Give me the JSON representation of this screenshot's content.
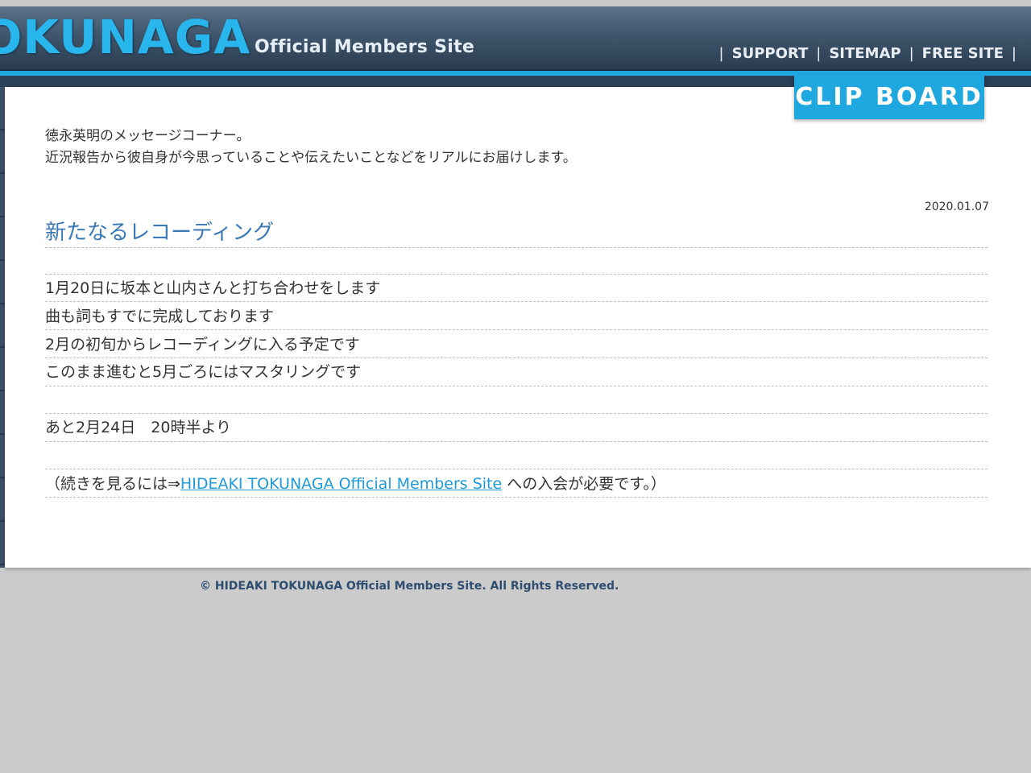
{
  "header": {
    "logo_main": "OKUNAGA",
    "logo_sub": "Official Members Site",
    "nav": [
      "SUPPORT",
      "SITEMAP",
      "FREE SITE"
    ],
    "separator": "|"
  },
  "clip_board_label": "CLIP BOARD",
  "intro": {
    "line1": "徳永英明のメッセージコーナー。",
    "line2": "近況報告から彼自身が今思っていることや伝えたいことなどをリアルにお届けします。"
  },
  "post": {
    "date": "2020.01.07",
    "title": "新たなるレコーディング",
    "lines": [
      "1月20日に坂本と山内さんと打ち合わせをします",
      "曲も詞もすでに完成しております",
      "2月の初旬からレコーディングに入る予定です",
      "このまま進むと5月ごろにはマスタリングです",
      "",
      "あと2月24日　20時半より"
    ],
    "continue_prefix": "（続きを見るには⇒",
    "continue_link": "HIDEAKI TOKUNAGA Official Members Site",
    "continue_suffix": " への入会が必要です。）"
  },
  "footer": "© HIDEAKI TOKUNAGA Official Members Site.  All Rights Reserved."
}
